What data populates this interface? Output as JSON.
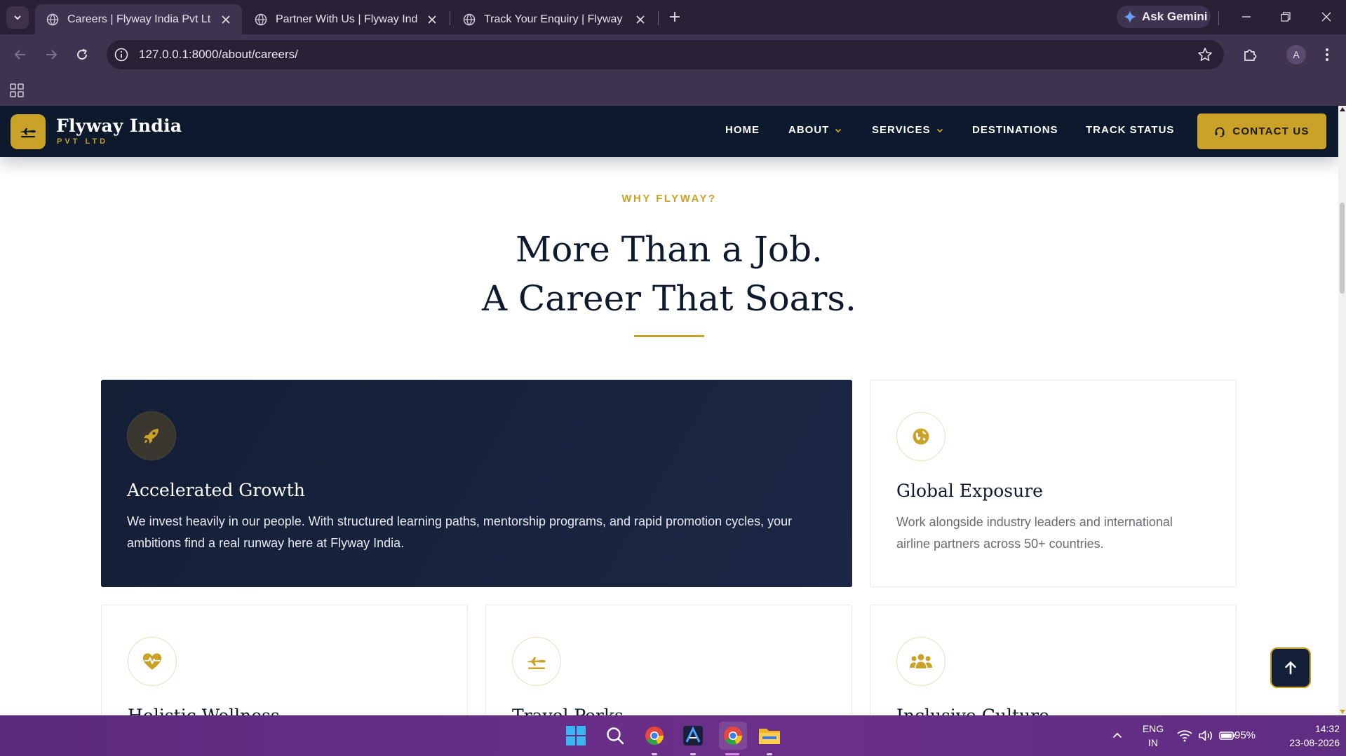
{
  "browser": {
    "tabs": [
      {
        "title": "Careers | Flyway India Pvt Ltd",
        "active": true
      },
      {
        "title": "Partner With Us | Flyway India",
        "active": false
      },
      {
        "title": "Track Your Enquiry | Flyway India",
        "active": false
      }
    ],
    "gemini_label": "Ask Gemini",
    "url": "127.0.0.1:8000/about/careers/",
    "profile_initial": "A"
  },
  "site": {
    "brand_name": "Flyway India",
    "brand_sub": "PVT LTD",
    "nav": [
      "HOME",
      "ABOUT",
      "SERVICES",
      "DESTINATIONS",
      "TRACK STATUS"
    ],
    "contact_label": "CONTACT US",
    "accent_color": "#c9a227",
    "navy_color": "#0d1a2d"
  },
  "section": {
    "eyebrow": "WHY FLYWAY?",
    "heading_line1": "More Than a Job.",
    "heading_line2": "A Career That Soars."
  },
  "cards": [
    {
      "icon": "rocket-icon",
      "title": "Accelerated Growth",
      "body": "We invest heavily in our people. With structured learning paths, mentorship programs, and rapid promotion cycles, your ambitions find a real runway here at Flyway India."
    },
    {
      "icon": "globe-icon",
      "title": "Global Exposure",
      "body": "Work alongside industry leaders and international airline partners across 50+ countries."
    },
    {
      "icon": "heartbeat-icon",
      "title": "Holistic Wellness",
      "body": ""
    },
    {
      "icon": "plane-icon",
      "title": "Travel Perks",
      "body": ""
    },
    {
      "icon": "users-icon",
      "title": "Inclusive Culture",
      "body": ""
    }
  ],
  "taskbar": {
    "lang_line1": "ENG",
    "lang_line2": "IN",
    "battery": "95%",
    "time": "14:32",
    "date": "23-08-2026"
  }
}
